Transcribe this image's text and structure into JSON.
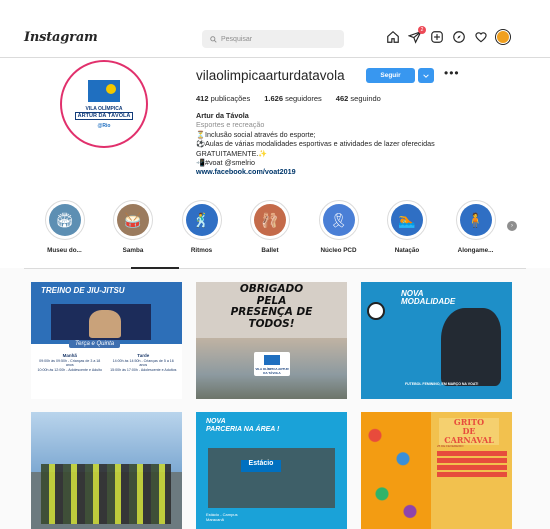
{
  "topbar": {
    "logo": "Instagram",
    "search_placeholder": "Pesquisar",
    "notification_count": "2"
  },
  "profile": {
    "picture_text": {
      "line1": "VILA OLÍMPICA",
      "line2": "ARTUR DA TÁVOLA",
      "line3": "@Rio"
    },
    "username": "vilaolimpicaarturdatavola",
    "follow_label": "Seguir",
    "stats": {
      "posts_count": "412",
      "posts_label": "publicações",
      "followers_count": "1.626",
      "followers_label": "seguidores",
      "following_count": "462",
      "following_label": "seguindo"
    },
    "bio": {
      "name": "Artur da Távola",
      "category": "Esportes e recreação",
      "line1": "⏳Inclusão social através do esporte;",
      "line2": "⚽Aulas de várias modalidades esportivas e atividades de lazer oferecidas",
      "line3": "GRATUITAMENTE.✨",
      "line4": "📲#voat @smelrio",
      "link": "www.facebook.com/voat2019"
    }
  },
  "highlights": [
    {
      "label": "Museu do...",
      "color": "#5d8fb3",
      "icon": "🏟"
    },
    {
      "label": "Samba",
      "color": "#9b7b5e",
      "icon": "🥁"
    },
    {
      "label": "Ritmos",
      "color": "#2f6fc4",
      "icon": "🕺"
    },
    {
      "label": "Ballet",
      "color": "#c46b4a",
      "icon": "🩰"
    },
    {
      "label": "Núcleo PCD",
      "color": "#4a7fd6",
      "icon": "🎗"
    },
    {
      "label": "Natação",
      "color": "#2f6fc4",
      "icon": "🏊"
    },
    {
      "label": "Alongame...",
      "color": "#2f6fc4",
      "icon": "🧍"
    }
  ],
  "posts": {
    "p1": {
      "title": "TREINO DE JIU-JITSU",
      "ribbon": "Terça e Quinta",
      "col1_head": "Manhã",
      "col1_line1": "09:00h às 09:50h - Crianças de 3 a 18 anos",
      "col1_line2": "10:00h às 12:00h - Adolescente e Adulto",
      "col2_head": "Tarde",
      "col2_line1": "14:00h às 14:50h - Crianças de 5 a 16 anos",
      "col2_line2": "15:00h às 17:00h - Adolescente e Adultos"
    },
    "p2": {
      "text_line1": "OBRIGADO",
      "text_line2": "PELA",
      "text_line3": "PRESENÇA DE",
      "text_line4": "TODOS!",
      "logo_text": "VILA OLÍMPICA ARTUR DA TÁVOLA"
    },
    "p3": {
      "line1": "NOVA",
      "line2": "MODALIDADE",
      "footer": "FUTEBOL FEMININO, EM MARÇO NA VOAT!"
    },
    "p5": {
      "line1": "NOVA",
      "line2": "PARCERIA NA ÁREA !",
      "sign": "Estácio",
      "footer1": "Estácio - Campus",
      "footer2": "Maracanã"
    },
    "p6": {
      "title_line1": "GRITO",
      "title_line2": "DE CARNAVAL",
      "date": "25 DE FEVEREIRO"
    }
  }
}
